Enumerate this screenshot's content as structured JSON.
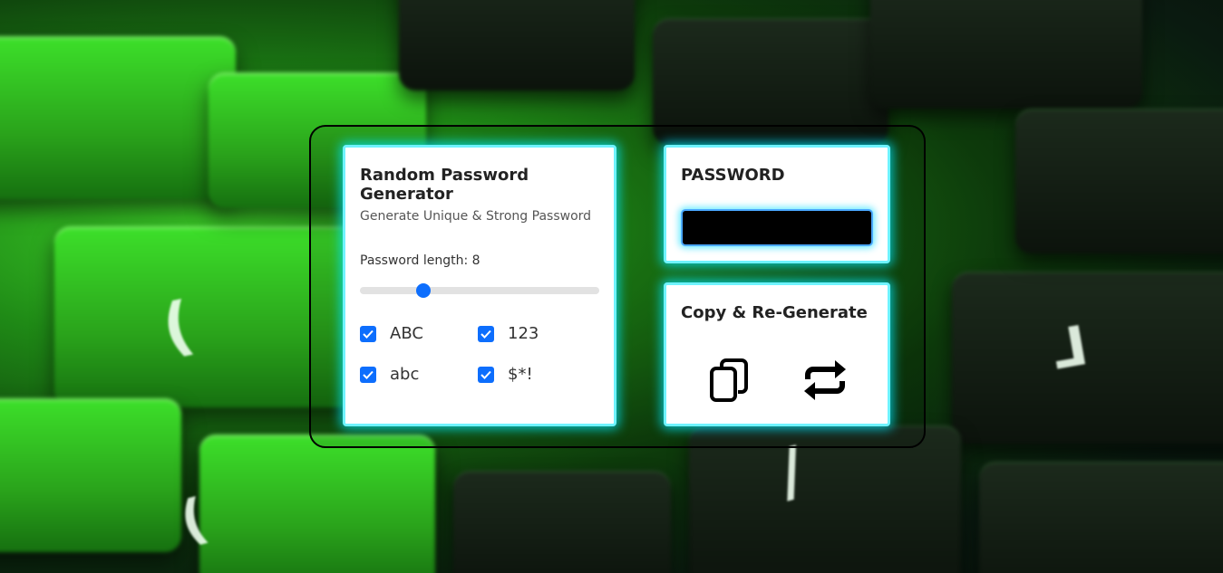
{
  "generator": {
    "title": "Random Password Generator",
    "subtitle": "Generate Unique & Strong Password",
    "length_label": "Password length: ",
    "length_value": "8",
    "length_slider": {
      "value": 8,
      "min": 4,
      "max": 20
    },
    "options": [
      {
        "label": "ABC",
        "checked": true
      },
      {
        "label": "123",
        "checked": true
      },
      {
        "label": "abc",
        "checked": true
      },
      {
        "label": "$*!",
        "checked": true
      }
    ]
  },
  "password": {
    "title": "PASSWORD",
    "value": ""
  },
  "actions": {
    "title": "Copy & Re-Generate",
    "copy_icon": "copy-icon",
    "regenerate_icon": "repeat-icon"
  },
  "colors": {
    "accent": "#0d6efd",
    "glow": "#00e6ff",
    "background": "#1f8a16"
  }
}
